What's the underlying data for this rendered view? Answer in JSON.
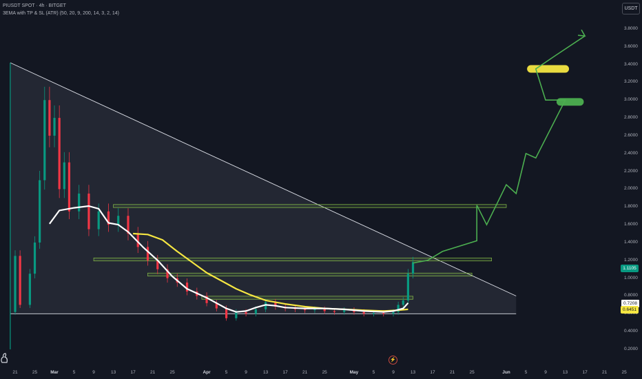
{
  "header": {
    "symbol_line": "PIUSDT SPOT · 4h · BITGET",
    "indicator_line": "3EMA with TP & SL (ATR) (50, 20, 9, 200, 14, 3, 2, 14)"
  },
  "currency_label": "USDT",
  "colors": {
    "background": "#131722",
    "candle_up": "#089981",
    "candle_down": "#f23645",
    "ema_white": "#ffffff",
    "ema_yellow": "#f5e642",
    "projection_green": "#4caf50",
    "zone_border": "#8bc34a",
    "triangle_fill": "#2a2e39"
  },
  "chart_data": {
    "type": "candlestick",
    "title": "PIUSDT SPOT · 4h · BITGET",
    "y_unit": "USDT",
    "yticks": [
      "3.8000",
      "3.6000",
      "3.4000",
      "3.2000",
      "3.0000",
      "2.8000",
      "2.6000",
      "2.4000",
      "2.2000",
      "2.0000",
      "1.8000",
      "1.6000",
      "1.4000",
      "1.2000",
      "1.0000",
      "0.8000",
      "0.6000",
      "0.4000",
      "0.2000"
    ],
    "xticks": [
      {
        "label": "21",
        "date": "2025-02-21"
      },
      {
        "label": "25",
        "date": "2025-02-25"
      },
      {
        "label": "Mar",
        "date": "2025-03-01",
        "bold": true
      },
      {
        "label": "5",
        "date": "2025-03-05"
      },
      {
        "label": "9",
        "date": "2025-03-09"
      },
      {
        "label": "13",
        "date": "2025-03-13"
      },
      {
        "label": "17",
        "date": "2025-03-17"
      },
      {
        "label": "21",
        "date": "2025-03-21"
      },
      {
        "label": "25",
        "date": "2025-03-25"
      },
      {
        "label": "Apr",
        "date": "2025-04-01",
        "bold": true
      },
      {
        "label": "5",
        "date": "2025-04-05"
      },
      {
        "label": "9",
        "date": "2025-04-09"
      },
      {
        "label": "13",
        "date": "2025-04-13"
      },
      {
        "label": "17",
        "date": "2025-04-17"
      },
      {
        "label": "21",
        "date": "2025-04-21"
      },
      {
        "label": "25",
        "date": "2025-04-25"
      },
      {
        "label": "May",
        "date": "2025-05-01",
        "bold": true
      },
      {
        "label": "5",
        "date": "2025-05-05"
      },
      {
        "label": "9",
        "date": "2025-05-09"
      },
      {
        "label": "13",
        "date": "2025-05-13"
      },
      {
        "label": "17",
        "date": "2025-05-17"
      },
      {
        "label": "21",
        "date": "2025-05-21"
      },
      {
        "label": "25",
        "date": "2025-05-25"
      },
      {
        "label": "Jun",
        "date": "2025-06-01",
        "bold": true
      },
      {
        "label": "5",
        "date": "2025-06-05"
      },
      {
        "label": "9",
        "date": "2025-06-09"
      },
      {
        "label": "13",
        "date": "2025-06-13"
      },
      {
        "label": "17",
        "date": "2025-06-17"
      },
      {
        "label": "21",
        "date": "2025-06-21"
      },
      {
        "label": "25",
        "date": "2025-06-25"
      }
    ],
    "price_tags": [
      {
        "value": 1.1105,
        "label": "1.1105",
        "style": "green"
      },
      {
        "value": 0.7208,
        "label": "0.7208",
        "style": "white"
      },
      {
        "value": 0.6451,
        "label": "0.6451",
        "style": "yellow"
      }
    ],
    "price_path": [
      [
        "2025-02-20",
        0.62
      ],
      [
        "2025-02-21",
        1.25
      ],
      [
        "2025-02-22",
        0.7
      ],
      [
        "2025-02-24",
        1.05
      ],
      [
        "2025-02-25",
        1.4
      ],
      [
        "2025-02-26",
        2.1
      ],
      [
        "2025-02-27",
        3.0
      ],
      [
        "2025-02-28",
        2.6
      ],
      [
        "2025-03-01",
        2.8
      ],
      [
        "2025-03-02",
        2.0
      ],
      [
        "2025-03-03",
        2.3
      ],
      [
        "2025-03-04",
        1.75
      ],
      [
        "2025-03-06",
        1.95
      ],
      [
        "2025-03-08",
        1.55
      ],
      [
        "2025-03-10",
        1.75
      ],
      [
        "2025-03-12",
        1.6
      ],
      [
        "2025-03-14",
        1.7
      ],
      [
        "2025-03-16",
        1.5
      ],
      [
        "2025-03-18",
        1.35
      ],
      [
        "2025-03-20",
        1.2
      ],
      [
        "2025-03-22",
        1.1
      ],
      [
        "2025-03-24",
        1.0
      ],
      [
        "2025-03-26",
        0.95
      ],
      [
        "2025-03-28",
        0.85
      ],
      [
        "2025-03-30",
        0.8
      ],
      [
        "2025-04-01",
        0.72
      ],
      [
        "2025-04-03",
        0.66
      ],
      [
        "2025-04-05",
        0.55
      ],
      [
        "2025-04-07",
        0.62
      ],
      [
        "2025-04-09",
        0.6
      ],
      [
        "2025-04-11",
        0.65
      ],
      [
        "2025-04-13",
        0.73
      ],
      [
        "2025-04-15",
        0.68
      ],
      [
        "2025-04-17",
        0.66
      ],
      [
        "2025-04-19",
        0.65
      ],
      [
        "2025-04-21",
        0.64
      ],
      [
        "2025-04-23",
        0.65
      ],
      [
        "2025-04-25",
        0.63
      ],
      [
        "2025-04-27",
        0.62
      ],
      [
        "2025-04-29",
        0.64
      ],
      [
        "2025-05-01",
        0.62
      ],
      [
        "2025-05-03",
        0.6
      ],
      [
        "2025-05-05",
        0.61
      ],
      [
        "2025-05-07",
        0.6
      ],
      [
        "2025-05-09",
        0.62
      ],
      [
        "2025-05-10",
        0.7
      ],
      [
        "2025-05-11",
        0.75
      ],
      [
        "2025-05-12",
        1.05
      ],
      [
        "2025-05-13",
        1.18
      ]
    ],
    "ema_white": [
      [
        "2025-02-28",
        1.61
      ],
      [
        "2025-03-02",
        1.76
      ],
      [
        "2025-03-05",
        1.79
      ],
      [
        "2025-03-08",
        1.81
      ],
      [
        "2025-03-10",
        1.78
      ],
      [
        "2025-03-12",
        1.62
      ],
      [
        "2025-03-14",
        1.6
      ],
      [
        "2025-03-16",
        1.52
      ],
      [
        "2025-03-19",
        1.35
      ],
      [
        "2025-03-22",
        1.2
      ],
      [
        "2025-03-25",
        1.02
      ],
      [
        "2025-03-28",
        0.88
      ],
      [
        "2025-04-01",
        0.78
      ],
      [
        "2025-04-03",
        0.72
      ],
      [
        "2025-04-05",
        0.66
      ],
      [
        "2025-04-07",
        0.62
      ],
      [
        "2025-04-09",
        0.63
      ],
      [
        "2025-04-11",
        0.67
      ],
      [
        "2025-04-13",
        0.7
      ],
      [
        "2025-04-15",
        0.69
      ],
      [
        "2025-04-17",
        0.67
      ],
      [
        "2025-04-21",
        0.66
      ],
      [
        "2025-04-25",
        0.66
      ],
      [
        "2025-04-29",
        0.65
      ],
      [
        "2025-05-03",
        0.63
      ],
      [
        "2025-05-07",
        0.62
      ],
      [
        "2025-05-09",
        0.63
      ],
      [
        "2025-05-11",
        0.66
      ],
      [
        "2025-05-12",
        0.72
      ]
    ],
    "ema_yellow": [
      [
        "2025-03-17",
        1.5
      ],
      [
        "2025-03-20",
        1.49
      ],
      [
        "2025-03-23",
        1.43
      ],
      [
        "2025-03-26",
        1.3
      ],
      [
        "2025-03-29",
        1.18
      ],
      [
        "2025-04-01",
        1.06
      ],
      [
        "2025-04-04",
        0.97
      ],
      [
        "2025-04-07",
        0.88
      ],
      [
        "2025-04-10",
        0.81
      ],
      [
        "2025-04-13",
        0.75
      ],
      [
        "2025-04-17",
        0.71
      ],
      [
        "2025-04-21",
        0.68
      ],
      [
        "2025-04-25",
        0.66
      ],
      [
        "2025-04-29",
        0.65
      ],
      [
        "2025-05-03",
        0.64
      ],
      [
        "2025-05-07",
        0.63
      ],
      [
        "2025-05-10",
        0.64
      ],
      [
        "2025-05-12",
        0.65
      ]
    ],
    "zones": [
      {
        "from": "2025-03-13",
        "to": "2025-06-01",
        "price": 1.81
      },
      {
        "from": "2025-03-09",
        "to": "2025-05-29",
        "price": 1.21
      },
      {
        "from": "2025-03-20",
        "to": "2025-05-25",
        "price": 1.04
      },
      {
        "from": "2025-03-31",
        "to": "2025-05-13",
        "price": 0.78
      }
    ],
    "triangle": {
      "apex": [
        "2025-02-20",
        3.42
      ],
      "right": [
        "2025-06-03",
        0.8
      ],
      "base": 0.6
    },
    "baseline": {
      "from": "2025-02-20",
      "to": "2025-06-03",
      "price": 0.6
    },
    "projection": [
      [
        "2025-05-13",
        1.17
      ],
      [
        "2025-05-16",
        1.2
      ],
      [
        "2025-05-19",
        1.3
      ],
      [
        "2025-05-26",
        1.42
      ],
      [
        "2025-05-26",
        1.82
      ],
      [
        "2025-05-28",
        1.6
      ],
      [
        "2025-06-01",
        2.05
      ],
      [
        "2025-06-03",
        1.95
      ],
      [
        "2025-06-05",
        2.4
      ],
      [
        "2025-06-07",
        2.35
      ],
      [
        "2025-06-13",
        3.0
      ],
      [
        "2025-06-09",
        3.0
      ],
      [
        "2025-06-07",
        3.35
      ],
      [
        "2025-06-11",
        3.5
      ],
      [
        "2025-06-17",
        3.72
      ]
    ],
    "projection_arrow_tip": [
      "2025-06-17",
      3.72
    ],
    "highlights": [
      {
        "date_from": "2025-06-06",
        "date_to": "2025-06-13",
        "price": 3.35,
        "color": "#f5e642"
      },
      {
        "date_from": "2025-06-12",
        "date_to": "2025-06-16",
        "price": 2.98,
        "color": "#4caf50"
      }
    ]
  }
}
